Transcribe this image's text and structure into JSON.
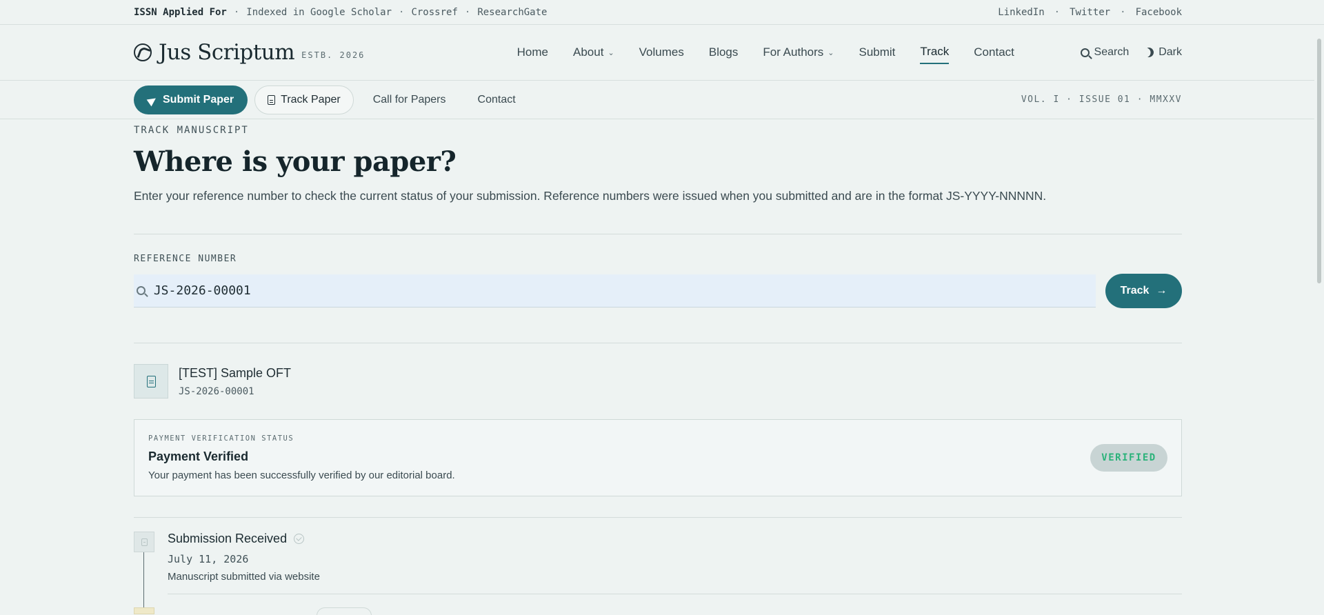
{
  "topstrip": {
    "issn": "ISSN Applied For",
    "indexed": [
      "Indexed in Google Scholar",
      "Crossref",
      "ResearchGate"
    ],
    "social": [
      "LinkedIn",
      "Twitter",
      "Facebook"
    ]
  },
  "header": {
    "brand": "Jus Scriptum",
    "est": "ESTB. 2026",
    "nav": [
      {
        "label": "Home"
      },
      {
        "label": "About"
      },
      {
        "label": "Volumes"
      },
      {
        "label": "Blogs"
      },
      {
        "label": "For Authors"
      },
      {
        "label": "Submit"
      },
      {
        "label": "Track"
      },
      {
        "label": "Contact"
      }
    ],
    "search_label": "Search",
    "theme_label": "Dark"
  },
  "subbar": {
    "submit_label": "Submit Paper",
    "track_label": "Track Paper",
    "call_label": "Call for Papers",
    "contact_label": "Contact",
    "issue": "VOL. I · ISSUE 01 · MMXXV"
  },
  "main": {
    "eyebrow": "TRACK MANUSCRIPT",
    "title": "Where is your paper?",
    "lead": "Enter your reference number to check the current status of your submission. Reference numbers were issued when you submitted and are in the format JS-YYYY-NNNNN.",
    "ref_label": "REFERENCE NUMBER",
    "ref_value": "JS-2026-00001",
    "track_button": "Track"
  },
  "result": {
    "title": "[TEST] Sample OFT",
    "ref": "JS-2026-00001",
    "payment": {
      "label": "PAYMENT VERIFICATION STATUS",
      "heading": "Payment Verified",
      "desc": "Your payment has been successfully verified by our editorial board.",
      "badge": "VERIFIED"
    },
    "timeline": [
      {
        "title": "Submission Received",
        "date": "July 11, 2026",
        "desc": "Manuscript submitted via website"
      }
    ]
  },
  "colors": {
    "accent": "#23707a",
    "background": "#eef3f2",
    "verified": "#2bb27a"
  }
}
